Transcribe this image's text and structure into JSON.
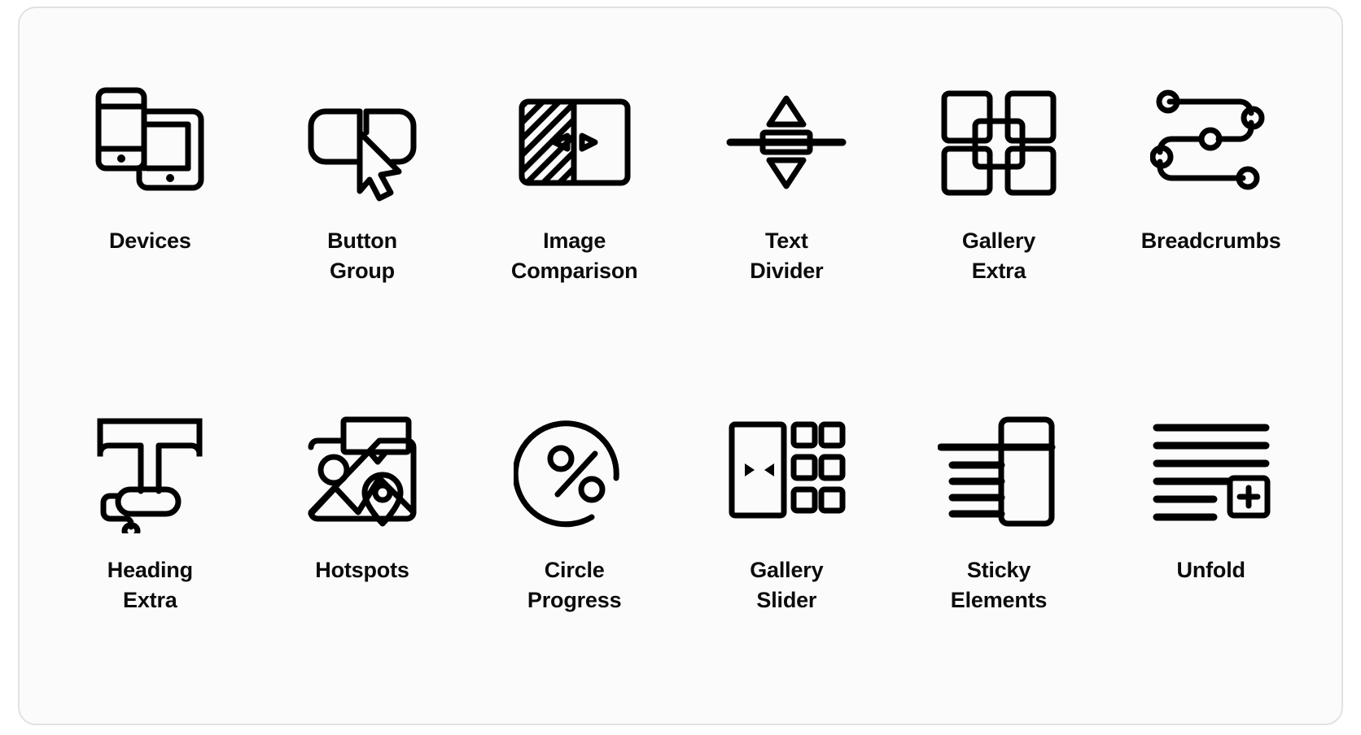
{
  "card": {
    "background": "#fbfbfb",
    "border_color": "#e2e2e4"
  },
  "grid": {
    "columns": 6,
    "rows": 2
  },
  "items": [
    {
      "label": "Devices",
      "icon": "devices-icon"
    },
    {
      "label": "Button\nGroup",
      "icon": "button-group-icon"
    },
    {
      "label": "Image\nComparison",
      "icon": "image-comparison-icon"
    },
    {
      "label": "Text\nDivider",
      "icon": "text-divider-icon"
    },
    {
      "label": "Gallery\nExtra",
      "icon": "gallery-extra-icon"
    },
    {
      "label": "Breadcrumbs",
      "icon": "breadcrumbs-icon"
    },
    {
      "label": "Heading\nExtra",
      "icon": "heading-extra-icon"
    },
    {
      "label": "Hotspots",
      "icon": "hotspots-icon"
    },
    {
      "label": "Circle\nProgress",
      "icon": "circle-progress-icon"
    },
    {
      "label": "Gallery\nSlider",
      "icon": "gallery-slider-icon"
    },
    {
      "label": "Sticky\nElements",
      "icon": "sticky-elements-icon"
    },
    {
      "label": "Unfold",
      "icon": "unfold-icon"
    }
  ],
  "style": {
    "stroke_color": "#000000",
    "label_color": "#0b0b0b"
  }
}
